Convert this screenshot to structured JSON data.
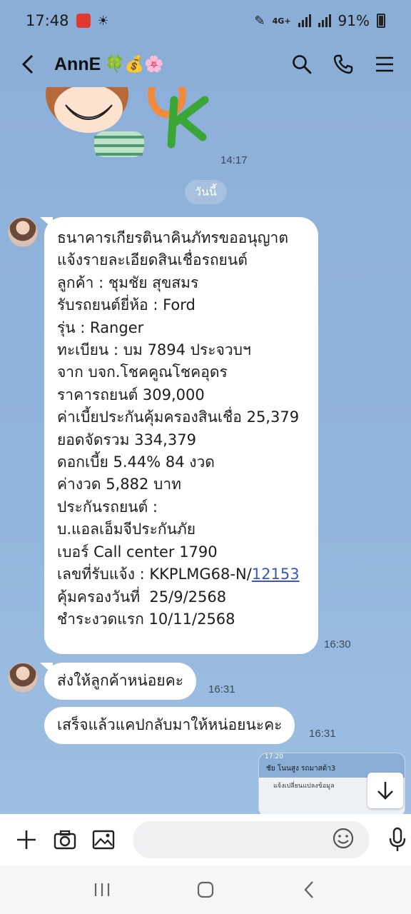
{
  "status_bar": {
    "time": "17:48",
    "network": "4G+",
    "battery": "91%"
  },
  "header": {
    "title": "AnnE",
    "title_emojis": "🍀💰🌸"
  },
  "chat": {
    "sticker_time": "14:17",
    "date_label": "วันนี้",
    "messages": [
      {
        "lines": [
          "ธนาคารเกียรตินาคินภัทรขออนุญาต",
          "แจ้งรายละเอียดสินเชื่อรถยนต์",
          "",
          "ลูกค้า : ชุมชัย สุขสมร",
          "รับรถยนต์ยี่ห้อ : Ford",
          "รุ่น : Ranger",
          "ทะเบียน : บม 7894 ประจวบฯ",
          "จาก บจก.โชคคูณโชคอุดร",
          "ราคารถยนต์ 309,000",
          "ค่าเบี้ยประกันคุ้มครองสินเชื่อ 25,379",
          "ยอดจัดรวม 334,379",
          "ดอกเบี้ย 5.44% 84 งวด",
          "ค่างวด 5,882 บาท",
          "ประกันรถยนต์ :",
          "บ.แอลเอ็มจีประกันภัย",
          "เบอร์ Call center 1790"
        ],
        "claim_prefix": "เลขที่รับแจ้ง : KKPLMG68-N/",
        "claim_link": "12153",
        "lines_after": [
          "คุ้มครองวันที่  25/9/2568",
          "ชำระงวดแรก 10/11/2568"
        ],
        "time": "16:30"
      },
      {
        "text": "ส่งให้ลูกค้าหน่อยคะ",
        "time": "16:31"
      },
      {
        "text": "เสร็จแล้วแคปกลับมาให้หน่อยนะคะ",
        "time": "16:31"
      }
    ],
    "preview": {
      "status": "17:20",
      "title": "ชัย โนนสูง รถมาสด้า3",
      "snippet": "แจ้งเปลี่ยนแปลงข้อมูล"
    }
  },
  "input": {
    "placeholder": ""
  },
  "colors": {
    "header_bg": "#8aaed6",
    "chat_bg": "#8fb3d8",
    "bubble_bg": "#ffffff",
    "link": "#3a55c8"
  }
}
